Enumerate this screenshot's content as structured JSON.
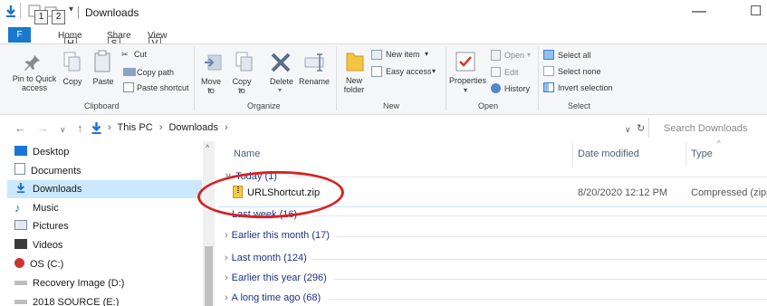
{
  "window": {
    "title": "Downloads",
    "quick_access_keytips": [
      "1",
      "2"
    ],
    "minimize": "—",
    "maximize": "☐"
  },
  "ribbon_tabs": {
    "file": "F",
    "home": "Home",
    "home_key": "H",
    "share": "Share",
    "share_key": "S",
    "view": "View",
    "view_key": "V"
  },
  "ribbon": {
    "clipboard": {
      "pin_to_quick_access": "Pin to Quick access",
      "copy": "Copy",
      "paste": "Paste",
      "cut": "Cut",
      "copy_path": "Copy path",
      "paste_shortcut": "Paste shortcut",
      "group": "Clipboard"
    },
    "organize": {
      "move_to": "Move to",
      "copy_to": "Copy to",
      "delete": "Delete",
      "rename": "Rename",
      "group": "Organize"
    },
    "new": {
      "new_folder": "New folder",
      "new_item": "New item",
      "easy_access": "Easy access",
      "group": "New"
    },
    "open": {
      "properties": "Properties",
      "open": "Open",
      "edit": "Edit",
      "history": "History",
      "group": "Open"
    },
    "select": {
      "select_all": "Select all",
      "select_none": "Select none",
      "invert_selection": "Invert selection",
      "group": "Select"
    }
  },
  "address": {
    "crumbs": [
      "This PC",
      "Downloads"
    ],
    "search_placeholder": "Search Downloads"
  },
  "nav_pane": {
    "items": [
      {
        "label": "Desktop",
        "icon": "desktop-icon",
        "color": "#1e73d8"
      },
      {
        "label": "Documents",
        "icon": "documents-icon",
        "color": "#7a8ba0"
      },
      {
        "label": "Downloads",
        "icon": "downloads-icon",
        "color": "#1e73d8"
      },
      {
        "label": "Music",
        "icon": "music-icon",
        "color": "#1e73d8"
      },
      {
        "label": "Pictures",
        "icon": "pictures-icon",
        "color": "#7a8ba0"
      },
      {
        "label": "Videos",
        "icon": "videos-icon",
        "color": "#3a3a3a"
      },
      {
        "label": "OS (C:)",
        "icon": "drive-icon",
        "color": "#c33"
      },
      {
        "label": "Recovery Image (D:)",
        "icon": "drive-icon",
        "color": "#777"
      },
      {
        "label": "2018 SOURCE (E:)",
        "icon": "drive-icon",
        "color": "#777"
      }
    ],
    "selected": "Downloads"
  },
  "columns": {
    "name": "Name",
    "date_modified": "Date modified",
    "type": "Type"
  },
  "groups": [
    {
      "label": "Today (1)",
      "expanded": true
    },
    {
      "label": "Last week (16)",
      "expanded": false
    },
    {
      "label": "Earlier this month (17)",
      "expanded": false
    },
    {
      "label": "Last month (124)",
      "expanded": false
    },
    {
      "label": "Earlier this year (296)",
      "expanded": false
    },
    {
      "label": "A long time ago (68)",
      "expanded": false
    }
  ],
  "files": [
    {
      "name": "URLShortcut.zip",
      "date": "8/20/2020 12:12 PM",
      "type": "Compressed (zipp"
    }
  ],
  "colors": {
    "accent": "#1979ca",
    "selection": "#cce8ff",
    "annotation": "#d42424"
  }
}
